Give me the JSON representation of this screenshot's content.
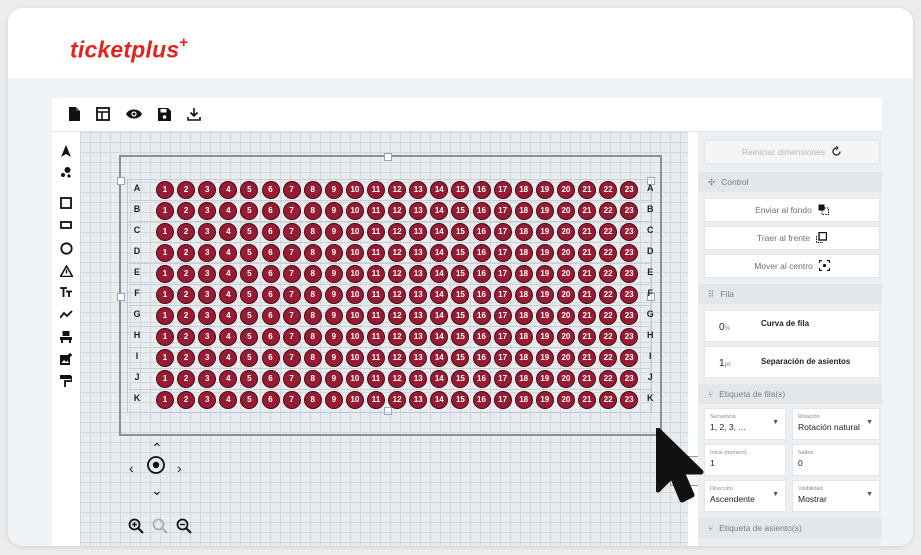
{
  "brand": {
    "name": "ticketplus",
    "plus": "+",
    "color": "#e3241b"
  },
  "toolbar": {
    "icons": [
      "file-icon",
      "layout-icon",
      "eye-icon",
      "save-icon",
      "download-icon"
    ]
  },
  "tools": [
    "arrow-icon",
    "dots-icon",
    "square-icon",
    "rectangle-icon",
    "circle-icon",
    "warning-icon",
    "text-icon",
    "line-chart-icon",
    "chair-icon",
    "image-add-icon",
    "paint-roller-icon"
  ],
  "seating": {
    "rows": [
      "A",
      "B",
      "C",
      "D",
      "E",
      "F",
      "G",
      "H",
      "I",
      "J",
      "K"
    ],
    "seats_per_row": 23,
    "seat_color": "#971b32"
  },
  "panel": {
    "reset_label": "Reiniciar dimensiones",
    "control_title": "Control",
    "send_back": "Enviar al fondo",
    "bring_front": "Traer al frente",
    "move_center": "Mover al centro",
    "fila_title": "Fila",
    "curve_value": "0",
    "curve_unit": "%",
    "curve_label": "Curva de fila",
    "sep_value": "1",
    "sep_unit": "px",
    "sep_label": "Separación de asientos",
    "row_label_title": "Etiqueta de fila(s)",
    "seq_label": "Secuencia",
    "seq_value": "1, 2, 3, ...",
    "rot_label": "Rotación",
    "rot_value": "Rotación natural",
    "start_label": "Inicio (número)",
    "start_value": "1",
    "jumps_label": "Saltos",
    "jumps_value": "0",
    "dir_label": "Dirección",
    "dir_value": "Ascendente",
    "vis_label": "Visibilidad",
    "vis_value": "Mostrar",
    "seat_label_title": "Etiqueta de asiento(s)"
  }
}
